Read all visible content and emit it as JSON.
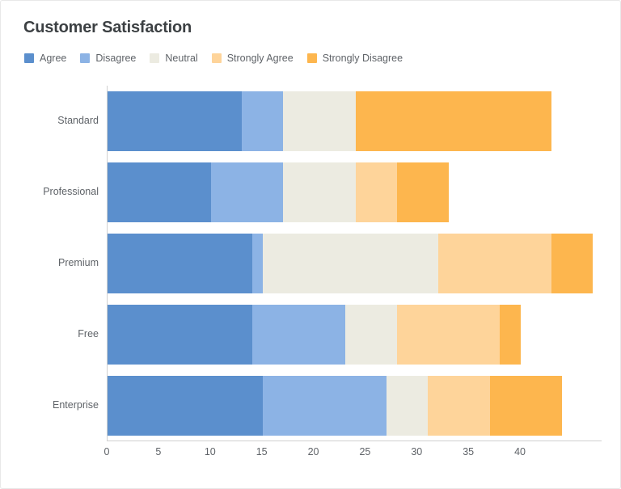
{
  "chart_data": {
    "type": "bar",
    "orientation": "horizontal",
    "stacked": true,
    "title": "Customer Satisfaction",
    "xlabel": "",
    "ylabel": "",
    "xlim": [
      0,
      47.9
    ],
    "xticks": [
      0,
      5,
      10,
      15,
      20,
      25,
      30,
      35,
      40
    ],
    "grid": false,
    "legend_position": "top-left",
    "categories": [
      "Standard",
      "Professional",
      "Premium",
      "Free",
      "Enterprise"
    ],
    "series": [
      {
        "name": "Agree",
        "color": "#5b8fcd",
        "values": [
          13,
          10,
          14,
          14,
          15
        ]
      },
      {
        "name": "Disagree",
        "color": "#8cb3e5",
        "values": [
          4,
          7,
          1,
          9,
          12
        ]
      },
      {
        "name": "Neutral",
        "color": "#ecebe1",
        "values": [
          7,
          7,
          17,
          5,
          4
        ]
      },
      {
        "name": "Strongly Agree",
        "color": "#fed49a",
        "values": [
          0,
          4,
          11,
          10,
          6
        ]
      },
      {
        "name": "Strongly Disagree",
        "color": "#fdb64e",
        "values": [
          19,
          5,
          4,
          2,
          7
        ]
      }
    ],
    "totals": [
      43,
      33,
      47,
      40,
      44
    ]
  },
  "legend": {
    "items": [
      {
        "label": "Agree",
        "color": "#5b8fcd"
      },
      {
        "label": "Disagree",
        "color": "#8cb3e5"
      },
      {
        "label": "Neutral",
        "color": "#ecebe1"
      },
      {
        "label": "Strongly Agree",
        "color": "#fed49a"
      },
      {
        "label": "Strongly Disagree",
        "color": "#fdb64e"
      }
    ]
  },
  "axis": {
    "x_tick_labels": [
      "0",
      "5",
      "10",
      "15",
      "20",
      "25",
      "30",
      "35",
      "40"
    ],
    "y_tick_labels": [
      "Standard",
      "Professional",
      "Premium",
      "Free",
      "Enterprise"
    ]
  },
  "colors": {
    "background": "#ffffff",
    "axis_line": "#d0d0d0",
    "title_text": "#3c4043",
    "label_text": "#5f6368",
    "card_border": "#e8e8e8"
  }
}
